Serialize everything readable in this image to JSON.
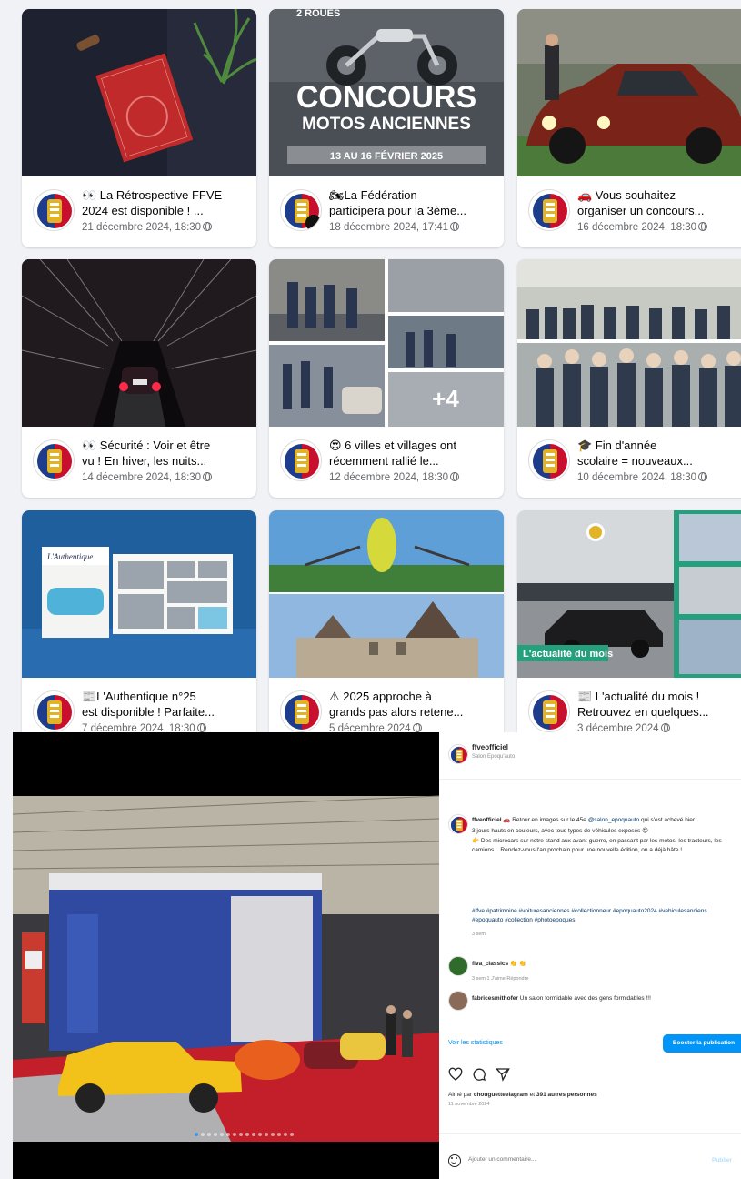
{
  "posts": [
    {
      "caption_l1": "👀 La Rétrospective FFVE",
      "caption_l2": "2024 est disponible ! ...",
      "date": "21 décembre 2024, 18:30",
      "thumb_text": ""
    },
    {
      "caption_l1": "🏍La Fédération",
      "caption_l2": "participera pour la 3ème...",
      "date": "18 décembre 2024, 17:41",
      "thumb_line0": "2 ROUES",
      "thumb_title": "CONCOURS",
      "thumb_subtitle": "MOTOS ANCIENNES",
      "thumb_dates": "13 AU 16 FÉVRIER 2025"
    },
    {
      "caption_l1": "🚗 Vous souhaitez",
      "caption_l2": "organiser un concours...",
      "date": "16 décembre 2024, 18:30"
    },
    {
      "caption_l1": "👀 Sécurité : Voir et être",
      "caption_l2": "vu ! En hiver, les nuits...",
      "date": "14 décembre 2024, 18:30"
    },
    {
      "caption_l1": "😍 6 villes et villages ont",
      "caption_l2": "récemment rallié le...",
      "date": "12 décembre 2024, 18:30",
      "more_count": "+4"
    },
    {
      "caption_l1": "🎓 Fin d'année",
      "caption_l2": "scolaire = nouveaux...",
      "date": "10 décembre 2024, 18:30"
    },
    {
      "caption_l1": "📰L'Authentique n°25",
      "caption_l2": "est disponible ! Parfaite...",
      "date": "7 décembre 2024, 18:30",
      "mag_title": "L'Authentique"
    },
    {
      "caption_l1": "⚠ 2025 approche à",
      "caption_l2": "grands pas alors retene...",
      "date": "5 décembre 2024"
    },
    {
      "caption_l1": "📰 L'actualité du mois !",
      "caption_l2": "Retrouvez en quelques...",
      "date": "3 décembre 2024",
      "thumb_banner": "L'actualité du mois"
    }
  ],
  "instagram": {
    "username": "ffveofficiel",
    "location": "Salon Epoqu'auto",
    "caption_user": "ffveofficiel",
    "caption_l1": " 🚗 Retour en images sur le 45e ",
    "caption_mention": "@salon_epoquauto",
    "caption_l1b": " qui s'est achevé hier.",
    "caption_l2": "3 jours hauts en couleurs, avec tous types de véhicules exposés 😍",
    "caption_l3": "👉 Des microcars sur notre stand aux avant-guerre, en passant par les motos, les tracteurs, les camions... Rendez-vous l'an prochain pour une nouvelle édition, on a déjà hâte !",
    "hashtags": "#ffve #patrimoine #voituresanciennes #collectionneur #epoquauto2024 #vehiculesanciens #epoquauto #collection #photoepoques",
    "time_ago": "3 sem",
    "comments": [
      {
        "user": "fiva_classics",
        "text": " 👏 👏",
        "meta": "3 sem   1 J'aime   Répondre"
      },
      {
        "user": "fabricesmithofer",
        "text": " Un salon formidable avec des gens formidables !!!",
        "meta": ""
      }
    ],
    "stats_link": "Voir les statistiques",
    "boost_label": "Booster la publication",
    "liked_prefix": "Aimé par ",
    "liked_user": "chouguetteelagram",
    "liked_mid": " et ",
    "liked_count": "391 autres personnes",
    "post_date": "11 novembre 2024",
    "comment_placeholder": "Ajouter un commentaire...",
    "publish_label": "Publier"
  },
  "colors": {
    "fb_bg": "#f0f2f5",
    "muted": "#65676b",
    "ig_blue": "#0095f6",
    "ffve_red": "#c8102e",
    "ffve_blue": "#1e3c8c",
    "ffve_gold": "#e2b327"
  }
}
